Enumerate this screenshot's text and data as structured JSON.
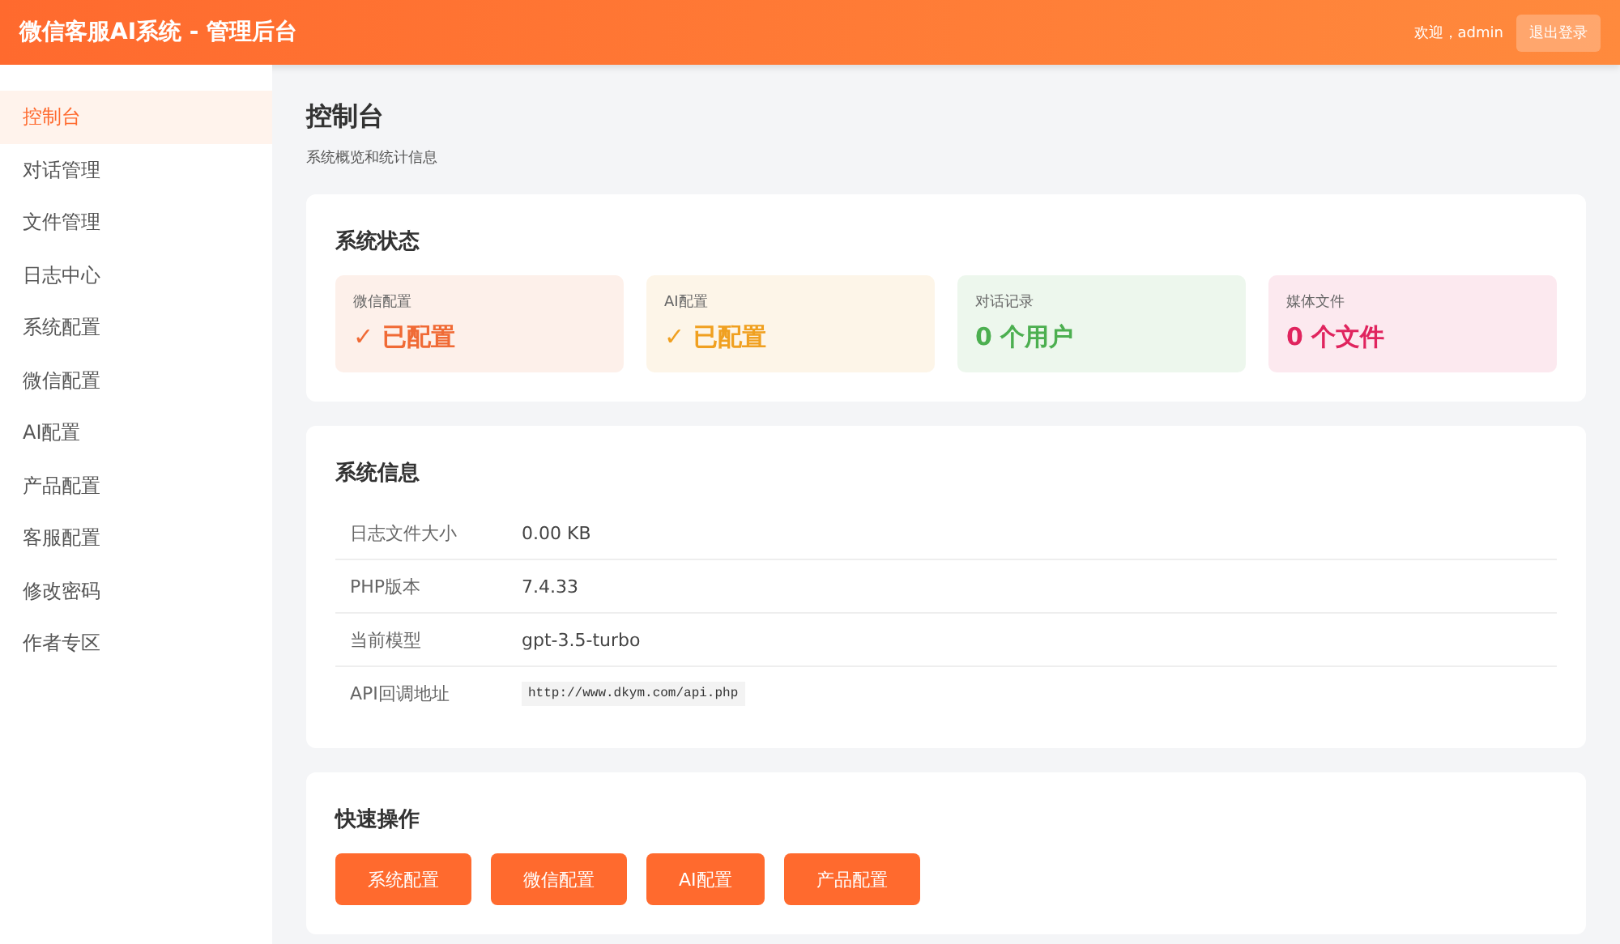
{
  "header": {
    "title": "微信客服AI系统 - 管理后台",
    "welcome": "欢迎，admin",
    "logout": "退出登录"
  },
  "sidebar": {
    "items": [
      {
        "label": "控制台",
        "selected": true
      },
      {
        "label": "对话管理",
        "selected": false
      },
      {
        "label": "文件管理",
        "selected": false
      },
      {
        "label": "日志中心",
        "selected": false
      },
      {
        "label": "系统配置",
        "selected": false
      },
      {
        "label": "微信配置",
        "selected": false
      },
      {
        "label": "AI配置",
        "selected": false
      },
      {
        "label": "产品配置",
        "selected": false
      },
      {
        "label": "客服配置",
        "selected": false
      },
      {
        "label": "修改密码",
        "selected": false
      },
      {
        "label": "作者专区",
        "selected": false
      }
    ]
  },
  "page": {
    "title": "控制台",
    "subtitle": "系统概览和统计信息"
  },
  "status": {
    "title": "系统状态",
    "cards": [
      {
        "label": "微信配置",
        "value": "✓ 已配置",
        "color": "#f06a35"
      },
      {
        "label": "AI配置",
        "value": "✓ 已配置",
        "color": "#f0a020"
      },
      {
        "label": "对话记录",
        "value": "0 个用户",
        "color": "#4caf50"
      },
      {
        "label": "媒体文件",
        "value": "0 个文件",
        "color": "#e0245e"
      }
    ]
  },
  "info": {
    "title": "系统信息",
    "rows": [
      {
        "label": "日志文件大小",
        "value": "0.00 KB",
        "kind": "text"
      },
      {
        "label": "PHP版本",
        "value": "7.4.33",
        "kind": "text"
      },
      {
        "label": "当前模型",
        "value": "gpt-3.5-turbo",
        "kind": "text"
      },
      {
        "label": "API回调地址",
        "value": "http://www.dkym.com/api.php",
        "kind": "code"
      }
    ]
  },
  "quick": {
    "title": "快速操作",
    "buttons": [
      "系统配置",
      "微信配置",
      "AI配置",
      "产品配置"
    ]
  }
}
